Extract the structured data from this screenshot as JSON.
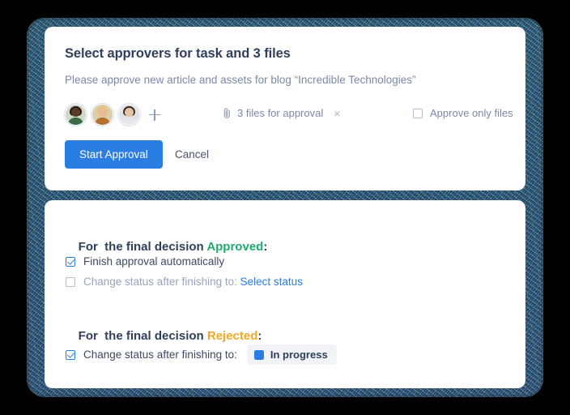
{
  "frame": {
    "border_color": "#1b4a63",
    "background": "#000000"
  },
  "approvers_card": {
    "title": "Select approvers for task and 3 files",
    "subtitle": "Please approve new article and assets for blog “Incredible Technologies”",
    "avatars": [
      {
        "name": "approver-1",
        "skin": "#5a3a28",
        "hair": "#241812",
        "shirt": "#3d6b44",
        "bg": "#cfd9c9"
      },
      {
        "name": "approver-2",
        "skin": "#e8bb97",
        "hair": "#e5c87c",
        "shirt": "#b8702e",
        "bg": "#d9cfae"
      },
      {
        "name": "approver-3",
        "skin": "#e6c3a8",
        "hair": "#3a2a22",
        "shirt": "#e8e8ea",
        "bg": "#dfe3e7"
      }
    ],
    "add_approver_label": "+",
    "files_chip": {
      "icon": "paperclip-icon",
      "label": "3 files for approval",
      "close": "×"
    },
    "approve_only": {
      "label": "Approve only files",
      "checked": false
    },
    "start_button": "Start Approval",
    "cancel_button": "Cancel",
    "primary_color": "#2a7de1"
  },
  "rules_card": {
    "approved_section": {
      "prefix": "For  the final decision ",
      "decision": "Approved",
      "suffix": ":",
      "decision_color": "#1eab6e",
      "rules": [
        {
          "label": "Finish approval automatically",
          "checked": true
        },
        {
          "label": "Change status after finishing to:",
          "checked": false,
          "link": "Select status"
        }
      ]
    },
    "rejected_section": {
      "prefix": "For  the final decision ",
      "decision": "Rejected",
      "suffix": ":",
      "decision_color": "#f5a623",
      "rules": [
        {
          "label": "Change status after finishing to:",
          "checked": true,
          "status": {
            "label": "In progress",
            "color": "#2a7de1"
          }
        }
      ]
    }
  }
}
